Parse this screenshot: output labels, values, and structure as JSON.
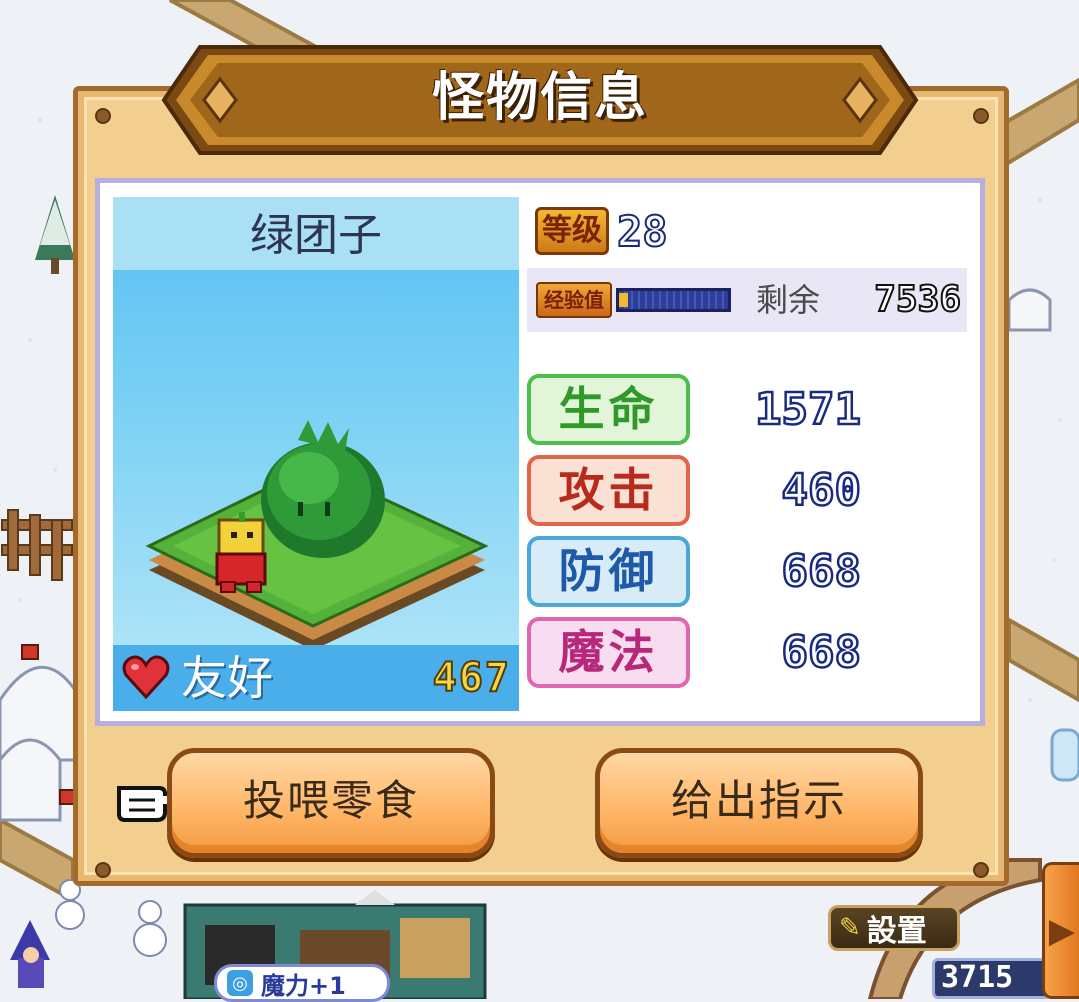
{
  "dialog": {
    "title": "怪物信息",
    "monster_name": "绿团子",
    "friendship": {
      "label": "友好",
      "value": "467"
    },
    "level": {
      "label": "等级",
      "value": "28"
    },
    "experience": {
      "label": "经验值",
      "progress": 0.08,
      "remaining_label": "剩余",
      "remaining_value": "7536"
    },
    "stats": [
      {
        "label": "生命",
        "value": "1571",
        "color": "#2f9a2a",
        "bg": "#e2f5d8",
        "border": "#4cbf4a"
      },
      {
        "label": "攻击",
        "value": "460",
        "color": "#b82a1a",
        "bg": "#fbe0d4",
        "border": "#e0664a"
      },
      {
        "label": "防御",
        "value": "668",
        "color": "#1f5aa8",
        "bg": "#d8ecf8",
        "border": "#4aa8d8"
      },
      {
        "label": "魔法",
        "value": "668",
        "color": "#b8287a",
        "bg": "#f8dcef",
        "border": "#e066b0"
      }
    ],
    "buttons": {
      "feed": "投喂零食",
      "instruct": "给出指示"
    }
  },
  "hud": {
    "settings_label": "設置",
    "coins": "3715",
    "magic_toast": "魔力+1"
  },
  "icons": {
    "heart": "heart-icon",
    "pointer": "hand-pointer-icon",
    "settings": "wand-icon",
    "side_arrow": "arrow-right-icon"
  }
}
